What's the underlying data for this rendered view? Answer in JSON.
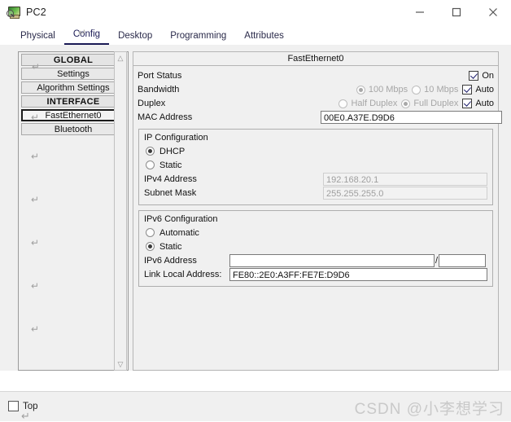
{
  "window": {
    "title": "PC2",
    "icon": "pc-device-icon",
    "controls": {
      "minimize": "minimize-icon",
      "maximize": "maximize-icon",
      "close": "close-icon"
    }
  },
  "tabs": [
    {
      "label": "Physical",
      "active": false
    },
    {
      "label": "Config",
      "active": true
    },
    {
      "label": "Desktop",
      "active": false
    },
    {
      "label": "Programming",
      "active": false
    },
    {
      "label": "Attributes",
      "active": false
    }
  ],
  "sidebar": {
    "items": [
      {
        "label": "GLOBAL",
        "type": "header"
      },
      {
        "label": "Settings",
        "type": "item"
      },
      {
        "label": "Algorithm Settings",
        "type": "item"
      },
      {
        "label": "INTERFACE",
        "type": "header"
      },
      {
        "label": "FastEthernet0",
        "type": "item",
        "selected": true
      },
      {
        "label": "Bluetooth",
        "type": "item"
      }
    ],
    "scrollbar": {
      "up": "chevron-up-icon",
      "down": "chevron-down-icon"
    }
  },
  "panel": {
    "title": "FastEthernet0",
    "port_status": {
      "label": "Port Status",
      "on_label": "On",
      "on_checked": true
    },
    "bandwidth": {
      "label": "Bandwidth",
      "options": [
        {
          "label": "100 Mbps",
          "selected": true,
          "disabled": true
        },
        {
          "label": "10 Mbps",
          "selected": false,
          "disabled": true
        }
      ],
      "auto_label": "Auto",
      "auto_checked": true
    },
    "duplex": {
      "label": "Duplex",
      "options": [
        {
          "label": "Half Duplex",
          "selected": false,
          "disabled": true
        },
        {
          "label": "Full Duplex",
          "selected": true,
          "disabled": true
        }
      ],
      "auto_label": "Auto",
      "auto_checked": true
    },
    "mac": {
      "label": "MAC Address",
      "value": "00E0.A37E.D9D6"
    },
    "ip_config": {
      "title": "IP Configuration",
      "dhcp_label": "DHCP",
      "dhcp_selected": true,
      "static_label": "Static",
      "static_selected": false,
      "ipv4_label": "IPv4 Address",
      "ipv4_value": "192.168.20.1",
      "subnet_label": "Subnet Mask",
      "subnet_value": "255.255.255.0"
    },
    "ipv6_config": {
      "title": "IPv6 Configuration",
      "automatic_label": "Automatic",
      "automatic_selected": false,
      "static_label": "Static",
      "static_selected": true,
      "ipv6_label": "IPv6 Address",
      "ipv6_value": "",
      "ipv6_prefix_value": "",
      "separator": "/",
      "link_local_label": "Link Local Address:",
      "link_local_value": "FE80::2E0:A3FF:FE7E:D9D6"
    }
  },
  "footer": {
    "top_label": "Top",
    "top_checked": false,
    "watermark": "CSDN @小李想学习"
  },
  "colors": {
    "accent": "#1b1b55",
    "panel_bg": "#f0f0f0",
    "border": "#aeaeae",
    "disabled_text": "#a6a6a6"
  }
}
